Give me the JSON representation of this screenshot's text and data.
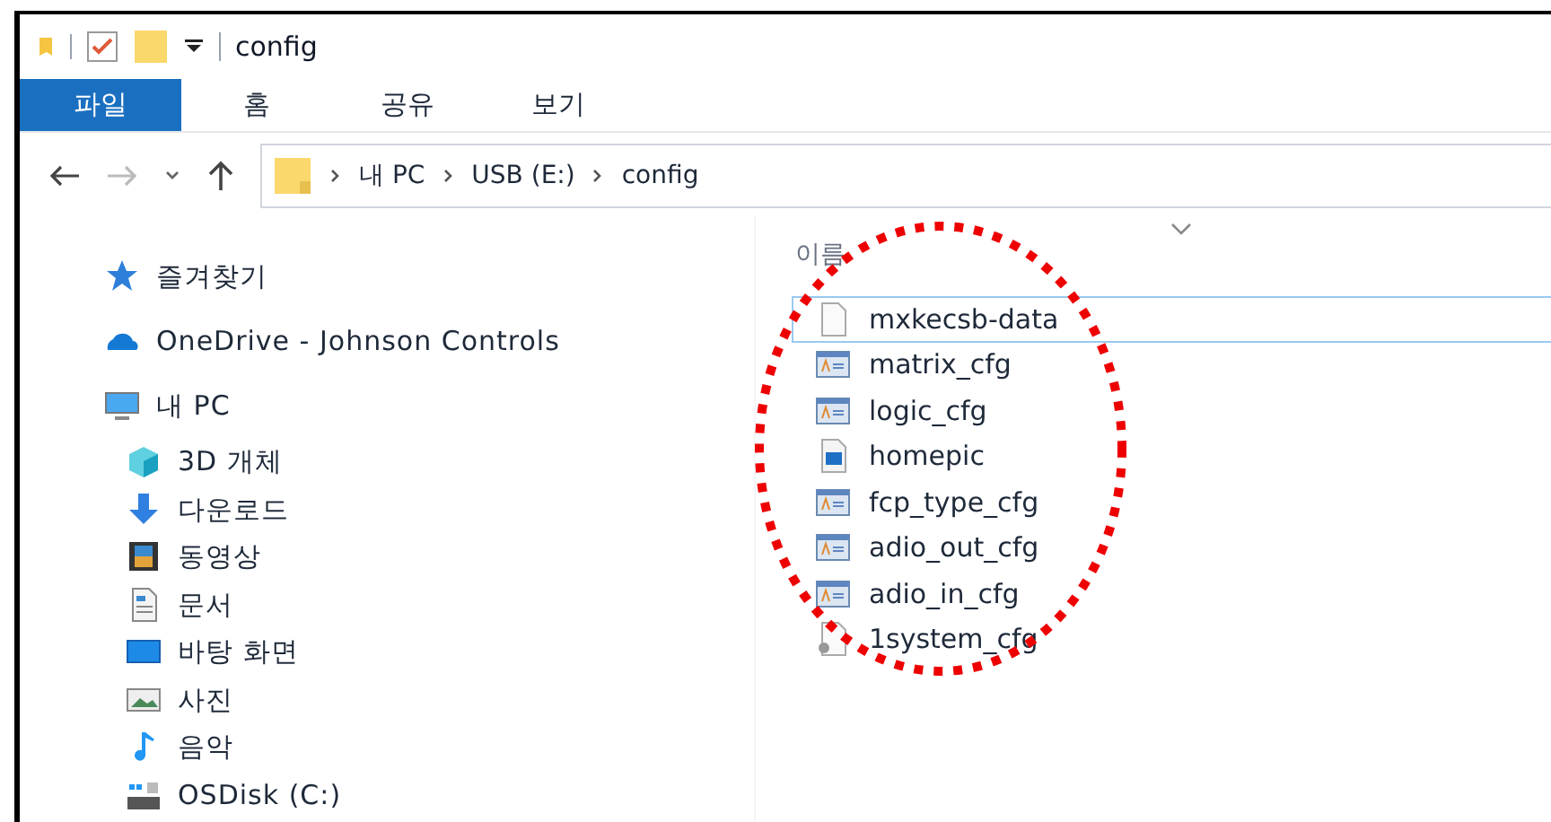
{
  "window": {
    "title": "config"
  },
  "ribbon_tabs": [
    {
      "label": "파일",
      "selected": true
    },
    {
      "label": "홈",
      "selected": false
    },
    {
      "label": "공유",
      "selected": false
    },
    {
      "label": "보기",
      "selected": false
    }
  ],
  "address_bar": {
    "segments": [
      "내 PC",
      "USB (E:)",
      "config"
    ]
  },
  "sidebar": {
    "items": [
      {
        "label": "즐겨찾기",
        "kind": "star"
      },
      {
        "label": "OneDrive - Johnson Controls",
        "kind": "cloud"
      },
      {
        "label": "내 PC",
        "kind": "pc",
        "children": [
          {
            "label": "3D 개체",
            "kind": "cube"
          },
          {
            "label": "다운로드",
            "kind": "download"
          },
          {
            "label": "동영상",
            "kind": "video"
          },
          {
            "label": "문서",
            "kind": "document"
          },
          {
            "label": "바탕 화면",
            "kind": "desktop"
          },
          {
            "label": "사진",
            "kind": "photo"
          },
          {
            "label": "음악",
            "kind": "music"
          },
          {
            "label": "OSDisk (C:)",
            "kind": "disk"
          }
        ]
      }
    ]
  },
  "file_list": {
    "column_header": "이름",
    "files": [
      {
        "name": "mxkecsb-data",
        "kind": "blank",
        "focused": true
      },
      {
        "name": "matrix_cfg",
        "kind": "config",
        "focused": false
      },
      {
        "name": "logic_cfg",
        "kind": "config",
        "focused": false
      },
      {
        "name": "homepic",
        "kind": "image",
        "focused": false
      },
      {
        "name": "fcp_type_cfg",
        "kind": "config",
        "focused": false
      },
      {
        "name": "adio_out_cfg",
        "kind": "config",
        "focused": false
      },
      {
        "name": "adio_in_cfg",
        "kind": "config",
        "focused": false
      },
      {
        "name": "1system_cfg",
        "kind": "system",
        "focused": false
      }
    ]
  }
}
